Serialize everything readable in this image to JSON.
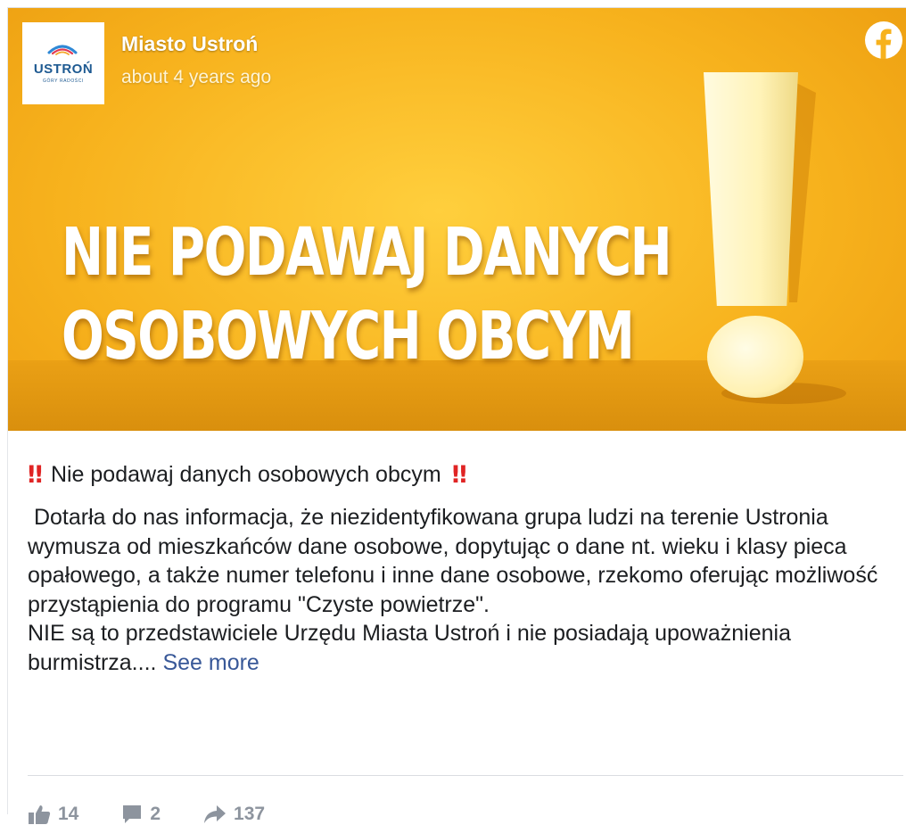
{
  "post": {
    "page_name": "Miasto Ustroń",
    "time": "about 4 years ago",
    "logo": {
      "text": "USTROŃ",
      "subtext": "GÓRY RADOŚCI"
    },
    "image": {
      "headline_1": "NIE PODAWAJ DANYCH",
      "headline_2": "OSOBOWYCH OBCYM"
    },
    "emoji": "‼",
    "title": "Nie podawaj danych osobowych obcym",
    "paragraph_1": " Dotarła do nas informacja, że niezidentyfikowana grupa ludzi na terenie Ustronia wymusza od mieszkańców dane osobowe, dopytując o dane nt. wieku i klasy pieca opałowego, a także numer telefonu i inne dane osobowe, rzekomo oferując możliwość przystąpienia do programu \"Czyste powietrze\".",
    "paragraph_2": "NIE są to przedstawiciele Urzędu Miasta Ustroń i nie posiadają upoważnienia burmistrza....",
    "see_more": "See more"
  },
  "stats": {
    "likes": "14",
    "comments": "2",
    "shares": "137"
  },
  "colors": {
    "accent_link": "#385898",
    "hero_yellow": "#f7b21d",
    "bang_red": "#e02424",
    "facebook_blue": "#1877f2"
  },
  "icons": [
    "facebook-icon",
    "like-icon",
    "comment-icon",
    "share-icon"
  ]
}
